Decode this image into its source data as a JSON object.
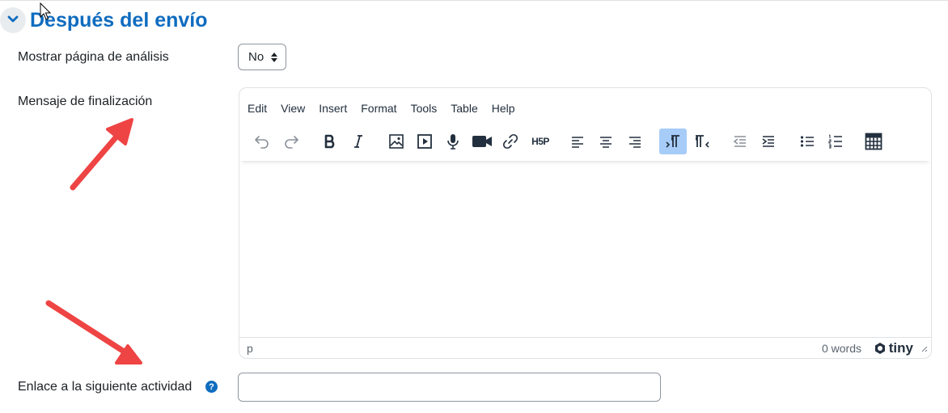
{
  "section": {
    "title": "Después del envío",
    "collapse_icon": "chevron-down-icon"
  },
  "form": {
    "show_analysis": {
      "label": "Mostrar página de análisis",
      "value": "No"
    },
    "completion_message": {
      "label": "Mensaje de finalización"
    },
    "next_activity_link": {
      "label": "Enlace a la siguiente actividad",
      "help_glyph": "?",
      "value": ""
    }
  },
  "editor": {
    "menu": [
      "Edit",
      "View",
      "Insert",
      "Format",
      "Tools",
      "Table",
      "Help"
    ],
    "toolbar_icons": [
      "undo-icon",
      "redo-icon",
      "bold-icon",
      "italic-icon",
      "image-icon",
      "media-icon",
      "microphone-icon",
      "video-camera-icon",
      "link-icon",
      "h5p-icon",
      "align-left-icon",
      "align-center-icon",
      "align-right-icon",
      "ltr-icon",
      "rtl-icon",
      "outdent-icon",
      "indent-icon",
      "bullet-list-icon",
      "numbered-list-icon",
      "calculator-icon"
    ],
    "h5p_label": "H5P",
    "status_path": "p",
    "word_count": "0 words",
    "brand": "tiny"
  },
  "colors": {
    "accent": "#0f6cbf",
    "annotation_arrow": "#ef4444",
    "active_button": "#a6ccf7"
  }
}
